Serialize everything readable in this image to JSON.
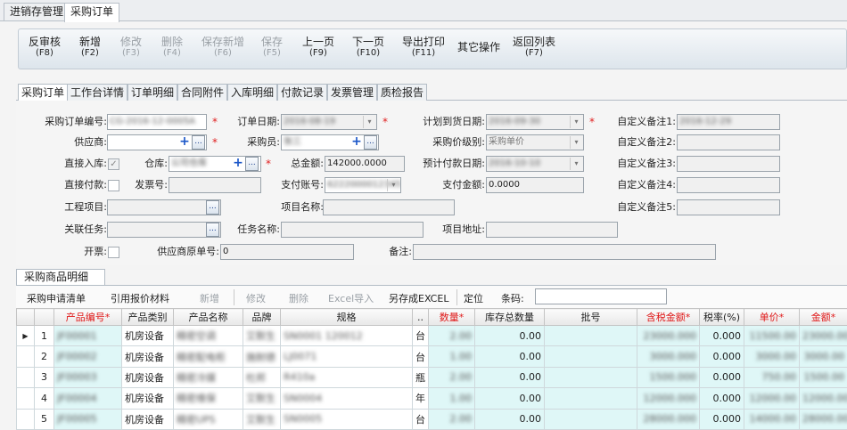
{
  "top_tabs": [
    "进销存管理",
    "采购订单"
  ],
  "toolbar": [
    {
      "label": "反审核",
      "key": "(F8)",
      "enabled": true
    },
    {
      "label": "新增",
      "key": "(F2)",
      "enabled": true
    },
    {
      "label": "修改",
      "key": "(F3)",
      "enabled": false
    },
    {
      "label": "删除",
      "key": "(F4)",
      "enabled": false
    },
    {
      "label": "保存新增",
      "key": "(F6)",
      "enabled": false
    },
    {
      "label": "保存",
      "key": "(F5)",
      "enabled": false
    },
    {
      "label": "上一页",
      "key": "(F9)",
      "enabled": true
    },
    {
      "label": "下一页",
      "key": "(F10)",
      "enabled": true
    },
    {
      "label": "导出打印",
      "key": "(F11)",
      "enabled": true
    },
    {
      "label": "其它操作",
      "key": "",
      "enabled": true
    },
    {
      "label": "返回列表",
      "key": "(F7)",
      "enabled": true
    }
  ],
  "sub_tabs": [
    "采购订单",
    "工作台详情",
    "订单明细",
    "合同附件",
    "入库明细",
    "付款记录",
    "发票管理",
    "质检报告"
  ],
  "form": {
    "order_no_label": "采购订单编号:",
    "order_no": "CG-2016-12-0005A",
    "order_date_label": "订单日期:",
    "order_date": "2016-08-19",
    "plan_date_label": "计划到货日期:",
    "plan_date": "2016-09-30",
    "custom1_label": "自定义备注1:",
    "custom1": "2016-12-29",
    "supplier_label": "供应商:",
    "buyer_label": "采购员:",
    "buyer": "张三",
    "price_level_label": "采购价级别:",
    "price_level": "采购单价",
    "custom2_label": "自定义备注2:",
    "direct_in_label": "直接入库:",
    "warehouse_label": "仓库:",
    "warehouse": "公司仓库",
    "total_label": "总金额:",
    "total": "142000.0000",
    "pay_date_label": "预计付款日期:",
    "pay_date": "2016-10-10",
    "custom3_label": "自定义备注3:",
    "direct_pay_label": "直接付款:",
    "invoice_label": "发票号:",
    "account_label": "支付账号:",
    "account": "6222000012345",
    "pay_amount_label": "支付金额:",
    "pay_amount": "0.0000",
    "custom4_label": "自定义备注4:",
    "project_label": "工程项目:",
    "project_name_label": "项目名称:",
    "custom5_label": "自定义备注5:",
    "task_label": "关联任务:",
    "task_name_label": "任务名称:",
    "project_addr_label": "项目地址:",
    "invoice_open_label": "开票:",
    "supplier_order_label": "供应商原单号:",
    "supplier_order": "0",
    "remark_label": "备注:"
  },
  "detail": {
    "tab_label": "采购商品明细",
    "toolbar": [
      {
        "label": "采购申请清单",
        "enabled": true
      },
      {
        "label": "引用报价材料",
        "enabled": true
      },
      {
        "label": "新增",
        "enabled": false
      },
      {
        "label": "修改",
        "enabled": false
      },
      {
        "label": "删除",
        "enabled": false
      },
      {
        "label": "Excel导入",
        "enabled": false
      },
      {
        "label": "另存成EXCEL",
        "enabled": true
      },
      {
        "label": "定位",
        "enabled": true
      }
    ],
    "barcode_label": "条码:",
    "columns": [
      "产品编号*",
      "产品类别",
      "产品名称",
      "品牌",
      "规格",
      "..",
      "数量*",
      "库存总数量",
      "批号",
      "含税金额*",
      "税率(%)",
      "单价*",
      "金额*"
    ],
    "rows": [
      {
        "num": "1",
        "code": "JF00001",
        "cat": "机房设备",
        "name": "精密空调",
        "brand": "艾默生",
        "spec": "SN0001 120012",
        "unit": "台",
        "qty": "2.00",
        "stock": "0.00",
        "tax_amount": "23000.000",
        "tax_rate": "0.000",
        "price": "11500.00",
        "amount": "23000.00"
      },
      {
        "num": "2",
        "code": "JF00002",
        "cat": "机房设备",
        "name": "精密配电柜",
        "brand": "施耐德",
        "spec": "LJ0071",
        "unit": "台",
        "qty": "1.00",
        "stock": "0.00",
        "tax_amount": "3000.000",
        "tax_rate": "0.000",
        "price": "3000.00",
        "amount": "3000.00"
      },
      {
        "num": "3",
        "code": "JF00003",
        "cat": "机房设备",
        "name": "精密冷媒",
        "brand": "杜邦",
        "spec": "R410a",
        "unit": "瓶",
        "qty": "2.00",
        "stock": "0.00",
        "tax_amount": "1500.000",
        "tax_rate": "0.000",
        "price": "750.00",
        "amount": "1500.00"
      },
      {
        "num": "4",
        "code": "JF00004",
        "cat": "机房设备",
        "name": "精密维保",
        "brand": "艾默生",
        "spec": "SN0004",
        "unit": "年",
        "qty": "1.00",
        "stock": "0.00",
        "tax_amount": "12000.000",
        "tax_rate": "0.000",
        "price": "12000.00",
        "amount": "12000.00"
      },
      {
        "num": "5",
        "code": "JF00005",
        "cat": "机房设备",
        "name": "精密UPS",
        "brand": "艾默生",
        "spec": "SN0005",
        "unit": "台",
        "qty": "2.00",
        "stock": "0.00",
        "tax_amount": "28000.000",
        "tax_rate": "0.000",
        "price": "14000.00",
        "amount": "28000.00"
      }
    ]
  }
}
